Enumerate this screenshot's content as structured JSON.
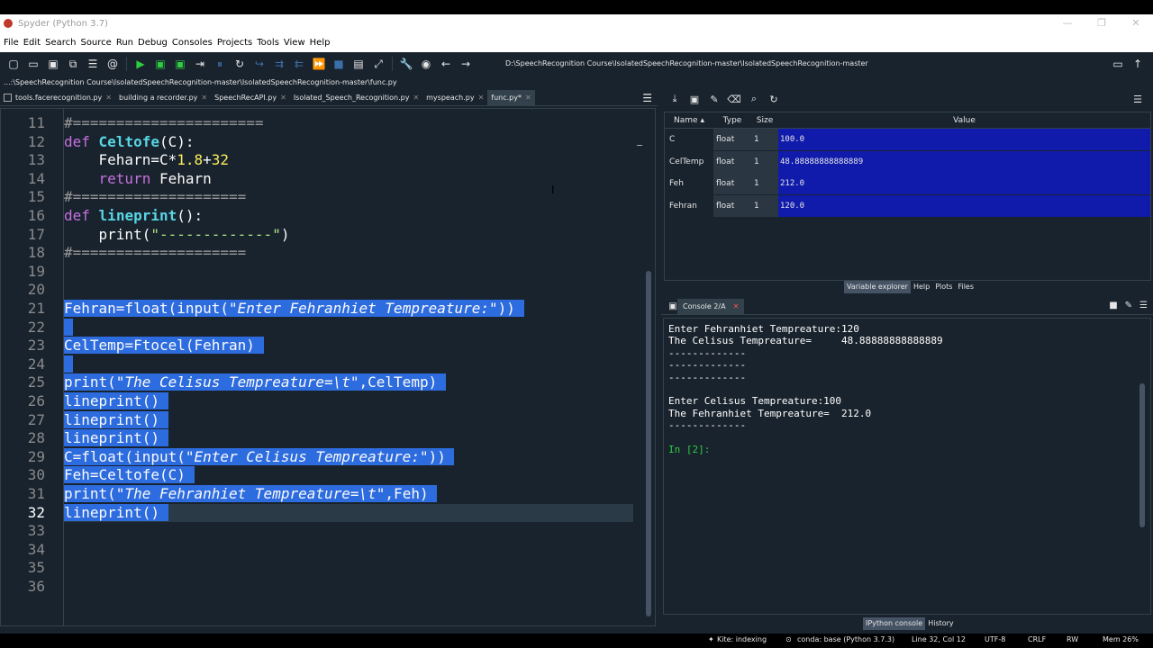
{
  "window": {
    "title": "Spyder (Python 3.7)",
    "minimize": "—",
    "restore": "❐",
    "close": "✕"
  },
  "menu": [
    "File",
    "Edit",
    "Search",
    "Source",
    "Run",
    "Debug",
    "Consoles",
    "Projects",
    "Tools",
    "View",
    "Help"
  ],
  "toolbar": {
    "path": "D:\\SpeechRecognition Course\\IsolatedSpeechRecognition-master\\IsolatedSpeechRecognition-master"
  },
  "editor": {
    "file_path": "...:\\SpeechRecognition Course\\IsolatedSpeechRecognition-master\\IsolatedSpeechRecognition-master\\func.py",
    "tabs": [
      {
        "label": "tools.facerecognition.py"
      },
      {
        "label": "building a recorder.py"
      },
      {
        "label": "SpeechRecAPI.py"
      },
      {
        "label": "Isolated_Speech_Recognition.py"
      },
      {
        "label": "myspeach.py"
      },
      {
        "label": "func.py*"
      }
    ],
    "active_tab": 5,
    "current_line": "32",
    "line_numbers": [
      "11",
      "12",
      "13",
      "14",
      "15",
      "16",
      "17",
      "18",
      "19",
      "20",
      "21",
      "22",
      "23",
      "24",
      "25",
      "26",
      "27",
      "28",
      "29",
      "30",
      "31",
      "32",
      "33",
      "34",
      "35",
      "36"
    ],
    "code": {
      "l11": "#======================",
      "l12_kw": "def",
      "l12_fn": "Celtofe",
      "l12_rest": "(C):",
      "l13_a": "    Feharn=C*",
      "l13_num1": "1.8",
      "l13_op": "+",
      "l13_num2": "32",
      "l14_kw": "    return",
      "l14_rest": " Feharn",
      "l15": "#====================",
      "l16_kw": "def",
      "l16_fn": "lineprint",
      "l16_rest": "():",
      "l17_a": "    print(",
      "l17_str": "\"-------------\"",
      "l17_b": ")",
      "l18": "#====================",
      "l21_a": "Fehran=float(input(",
      "l21_str": "\"Enter Fehranhiet Tempreature:\"",
      "l21_b": "))",
      "l23": "CelTemp=Ftocel(Fehran)",
      "l25_a": "print(",
      "l25_str": "\"The Celisus Tempreature=\\t\"",
      "l25_b": ",CelTemp)",
      "l26": "lineprint()",
      "l27": "lineprint()",
      "l28": "lineprint()",
      "l29_a": "C=float(input(",
      "l29_str": "\"Enter Celisus Tempreature:\"",
      "l29_b": "))",
      "l30": "Feh=Celtofe(C)",
      "l31_a": "print(",
      "l31_str": "\"The Fehranhiet Tempreature=\\t\"",
      "l31_b": ",Feh)",
      "l32": "lineprint()"
    }
  },
  "variable_explorer": {
    "headers": {
      "name": "Name",
      "type": "Type",
      "size": "Size",
      "value": "Value"
    },
    "rows": [
      {
        "name": "C",
        "type": "float",
        "size": "1",
        "value": "100.0"
      },
      {
        "name": "CelTemp",
        "type": "float",
        "size": "1",
        "value": "48.88888888888889"
      },
      {
        "name": "Feh",
        "type": "float",
        "size": "1",
        "value": "212.0"
      },
      {
        "name": "Fehran",
        "type": "float",
        "size": "1",
        "value": "120.0"
      }
    ],
    "tabs": [
      "Variable explorer",
      "Help",
      "Plots",
      "Files"
    ]
  },
  "console": {
    "tab_label": "Console 2/A",
    "lines": [
      "Enter Fehranhiet Tempreature:120",
      "The Celisus Tempreature=     48.88888888888889",
      "-------------",
      "-------------",
      "-------------",
      "",
      "Enter Celisus Tempreature:100",
      "The Fehranhiet Tempreature=  212.0",
      "-------------",
      "",
      "In [2]:"
    ],
    "bottom_tabs": [
      "IPython console",
      "History"
    ]
  },
  "status": {
    "kite": "Kite: indexing",
    "conda": "conda: base (Python 3.7.3)",
    "position": "Line 32, Col 12",
    "encoding": "UTF-8",
    "eol": "CRLF",
    "rw": "RW",
    "mem": "Mem 26%"
  }
}
